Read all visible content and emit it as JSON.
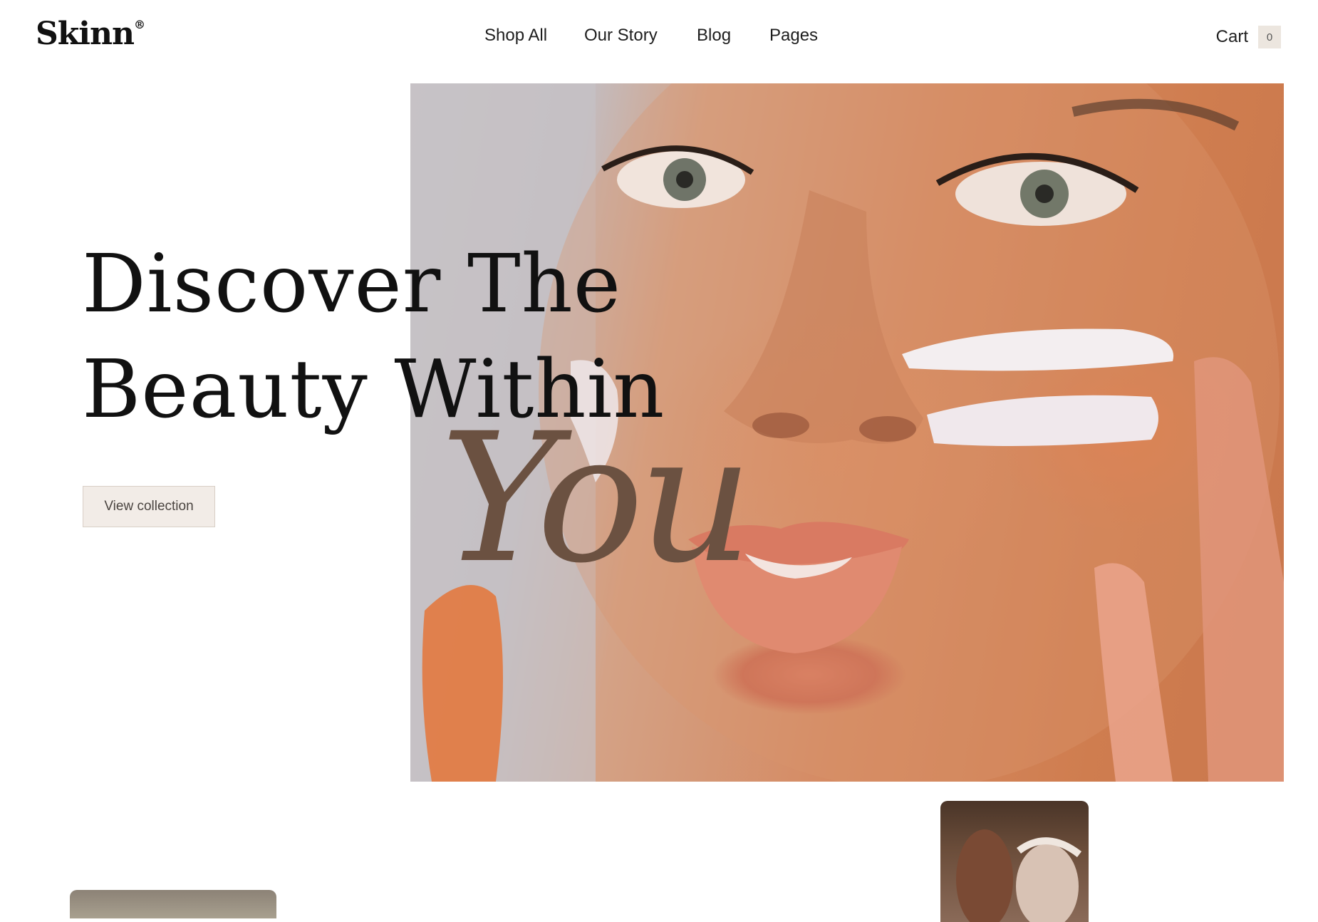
{
  "brand": {
    "name": "Skinn",
    "mark": "®"
  },
  "nav": {
    "items": [
      {
        "label": "Shop All"
      },
      {
        "label": "Our Story"
      },
      {
        "label": "Blog"
      },
      {
        "label": "Pages"
      }
    ]
  },
  "cart": {
    "label": "Cart",
    "count": "0"
  },
  "hero": {
    "headline_line1": "Discover The",
    "headline_line2": "Beauty Within",
    "script_word": "You",
    "cta_label": "View collection",
    "image_icon": "face-skincare-photo"
  },
  "colors": {
    "accent": "#6b5141",
    "button_bg": "#f2ece7",
    "cart_badge_bg": "#ece6df"
  }
}
